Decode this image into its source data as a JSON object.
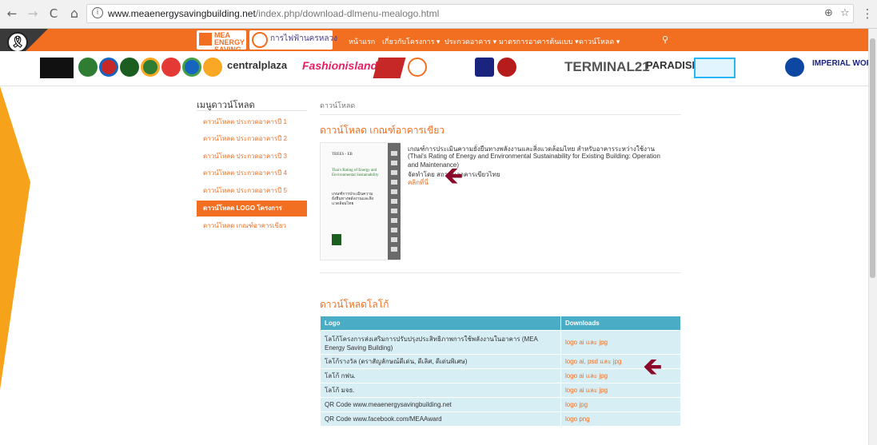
{
  "browser": {
    "url_host": "www.meaenergysavingbuilding.net",
    "url_path": "/index.php/download-dlmenu-mealogo.html",
    "back": "←",
    "forward": "→",
    "reload": "C",
    "home": "⌂",
    "info": "i",
    "zoom": "⊕",
    "star": "☆",
    "menu": "⋮"
  },
  "header": {
    "mea_logo_text": "MEA ENERGY SAVING",
    "authority_name": "การไฟฟ้านครหลวง",
    "menu": [
      "หน้าแรก",
      "เกี่ยวกับโครงการ ▾",
      "ประกวดอาคาร ▾",
      "มาตรการอาคารต้นแบบ ▾",
      "ดาวน์โหลด ▾"
    ],
    "search_icon": "🔍"
  },
  "partners": {
    "central": "centralplaza",
    "fashion": "Fashionisland",
    "terminal": "TERMINAL21",
    "paradise": "PARADISE",
    "imperial": "IMPERIAL WORLD"
  },
  "sidebar": {
    "title": "เมนูดาวน์โหลด",
    "items": [
      {
        "label": "ดาวน์โหลด ประกวดอาคารปี 1"
      },
      {
        "label": "ดาวน์โหลด ประกวดอาคารปี 2"
      },
      {
        "label": "ดาวน์โหลด ประกวดอาคารปี 3"
      },
      {
        "label": "ดาวน์โหลด ประกวดอาคารปี 4"
      },
      {
        "label": "ดาวน์โหลด ประกวดอาคารปี 5"
      },
      {
        "label": "ดาวน์โหลด LOGO โครงการ"
      },
      {
        "label": "ดาวน์โหลด เกณฑ์อาคารเขียว"
      }
    ]
  },
  "main": {
    "breadcrumb": "ดาวน์โหลด",
    "section1_title": "ดาวน์โหลด เกณฑ์อาคารเขียว",
    "book": {
      "code": "TREES - EB",
      "title_en": "Thai's Rating of Energy and Environmental Sustainability",
      "title_th": "เกณฑ์การประเมินความยั่งยืนทางพลังงานและสิ่งแวดล้อมไทย"
    },
    "doc_lines": [
      "เกณฑ์การประเมินความยั่งยืนทางพลังงานและสิ่งแวดล้อมไทย สำหรับอาคารระหว่างใช้งาน",
      "(Thai's Rating of Energy and Environmental Sustainability for Existing Building: Operation",
      "and Maintenance)",
      "จัดทำโดย สถาบันอาคารเขียวไทย"
    ],
    "doc_link": "คลิกที่นี่",
    "arrow": "🡸",
    "section2_title": "ดาวน์โหลดโลโก้",
    "table": {
      "headers": [
        "Logo",
        "Downloads"
      ],
      "rows": [
        {
          "logo": "โลโก้โครงการส่งเสริมการปรับปรุงประสิทธิภาพการใช้พลังงานในอาคาร (MEA Energy Saving Building)",
          "download": "logo ai และ jpg"
        },
        {
          "logo": "โลโก้รางวัล (ตราสัญลักษณ์ดีเด่น, ดีเลิศ, ดีเด่นพิเศษ)",
          "download": "logo ai, psd และ jpg"
        },
        {
          "logo": "โลโก้ กฟน.",
          "download": "logo ai และ jpg"
        },
        {
          "logo": "โลโก้ มจธ.",
          "download": "logo ai และ jpg"
        },
        {
          "logo": "QR Code www.meaenergysavingbuilding.net",
          "download": "logo jpg"
        },
        {
          "logo": "QR Code www.facebook.com/MEAAward",
          "download": "logo png"
        }
      ]
    }
  },
  "colors": {
    "brand_orange": "#f26f21",
    "table_header": "#4bacc6",
    "table_row": "#d7eef4",
    "arrow": "#8b0a2a"
  }
}
